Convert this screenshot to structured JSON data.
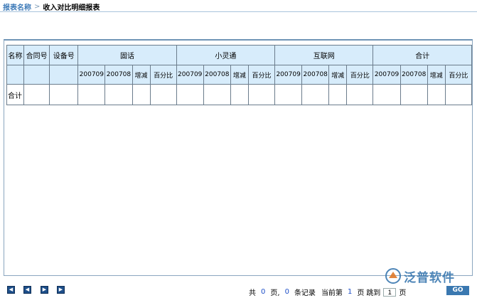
{
  "breadcrumb": {
    "root": "报表名称",
    "separator": ">",
    "current": "收入对比明细报表"
  },
  "table": {
    "fixed_headers": [
      "名称",
      "合同号",
      "设备号"
    ],
    "groups": [
      "固话",
      "小灵通",
      "互联网",
      "合计"
    ],
    "sub_headers": [
      "200709",
      "200708",
      "增减",
      "百分比"
    ],
    "total_row_label": "合计"
  },
  "pager": {
    "total_prefix": "共",
    "total_pages": "0",
    "pages_unit": "页,",
    "total_records": "0",
    "records_unit": "条记录",
    "current_prefix": "当前第",
    "current_page": "1",
    "current_unit": "页",
    "jump_label": "跳到",
    "jump_value": "1",
    "jump_unit": "页",
    "go_label": "GO"
  },
  "watermark": {
    "text": "泛普软件"
  },
  "colors": {
    "header_bg": "#d7ecfb",
    "accent": "#3a78b0",
    "breadcrumb_link": "#3d7ab8"
  }
}
